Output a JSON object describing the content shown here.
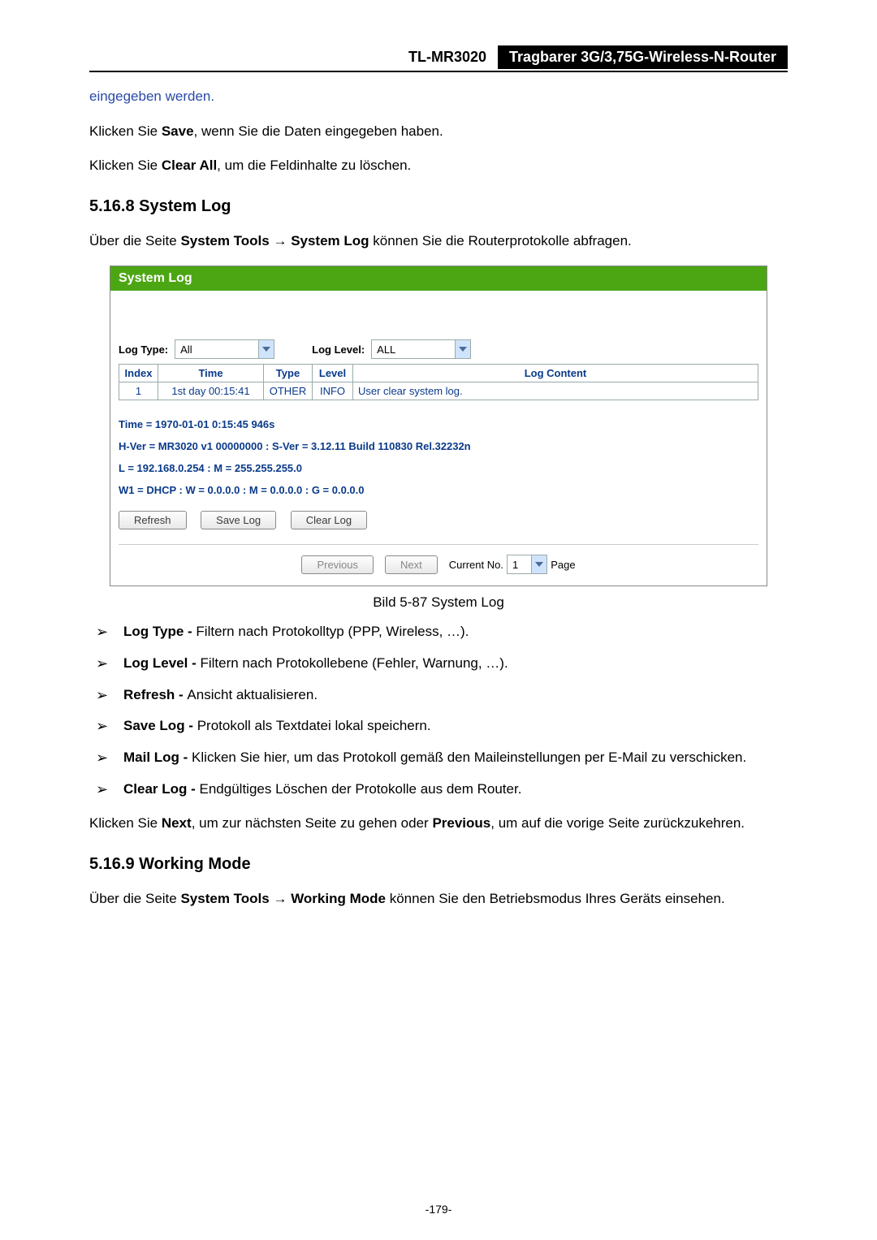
{
  "header": {
    "model": "TL-MR3020",
    "title": "Tragbarer 3G/3,75G-Wireless-N-Router"
  },
  "top_note": "eingegeben werden.",
  "save_line": {
    "pre": "Klicken Sie ",
    "bold": "Save",
    "post": ", wenn Sie die Daten eingegeben haben."
  },
  "clear_line": {
    "pre": "Klicken Sie ",
    "bold": "Clear All",
    "post": ", um die Feldinhalte zu löschen."
  },
  "h1": "5.16.8  System Log",
  "intro1": {
    "pre": "Über die Seite ",
    "b1": "System Tools",
    "mid": " → ",
    "b2": "System Log",
    "post": " können Sie die Routerprotokolle abfragen."
  },
  "panel": {
    "banner": "System Log",
    "filters": {
      "type_label": "Log Type:",
      "type_value": "All",
      "level_label": "Log Level:",
      "level_value": "ALL"
    },
    "columns": {
      "index": "Index",
      "time": "Time",
      "type": "Type",
      "level": "Level",
      "content": "Log Content"
    },
    "rows": [
      {
        "index": "1",
        "time": "1st day 00:15:41",
        "type": "OTHER",
        "level": "INFO",
        "content": "User clear system log."
      }
    ],
    "info": {
      "time": "Time = 1970-01-01 0:15:45 946s",
      "ver": "H-Ver = MR3020 v1 00000000 : S-Ver = 3.12.11 Build 110830 Rel.32232n",
      "lan": "L = 192.168.0.254 : M = 255.255.255.0",
      "wan": "W1 = DHCP : W = 0.0.0.0 : M = 0.0.0.0 : G = 0.0.0.0"
    },
    "buttons": {
      "refresh": "Refresh",
      "save": "Save Log",
      "clear": "Clear Log"
    },
    "pager": {
      "prev": "Previous",
      "next": "Next",
      "current_label": "Current No.",
      "current_value": "1",
      "page_label": "Page"
    }
  },
  "caption": "Bild 5-87 System Log",
  "desc": {
    "logtype": {
      "b": "Log Type - ",
      "t": "Filtern nach Protokolltyp (PPP, Wireless, …)."
    },
    "loglevel": {
      "b": "Log Level - ",
      "t": "Filtern nach Protokollebene (Fehler, Warnung, …)."
    },
    "refresh": {
      "b": "Refresh - ",
      "t": "Ansicht aktualisieren."
    },
    "savelog": {
      "b": "Save Log - ",
      "t": "Protokoll als Textdatei lokal speichern."
    },
    "maillog": {
      "b": "Mail Log - ",
      "t": "Klicken Sie hier, um das Protokoll gemäß den Maileinstellungen per E-Mail zu verschicken."
    },
    "clearlog": {
      "b": "Clear Log - ",
      "t": "Endgültiges Löschen der Protokolle aus dem Router."
    }
  },
  "nav_line": {
    "p1": "Klicken Sie ",
    "b1": "Next",
    "p2": ", um zur nächsten Seite zu gehen oder ",
    "b2": "Previous",
    "p3": ", um auf die vorige Seite zurückzukehren."
  },
  "h2": "5.16.9  Working Mode",
  "intro2": {
    "pre": "Über die Seite ",
    "b1": "System Tools",
    "mid": " → ",
    "b2": "Working Mode",
    "post": " können Sie den Betriebsmodus Ihres Geräts einsehen."
  },
  "page_no": "-179-"
}
